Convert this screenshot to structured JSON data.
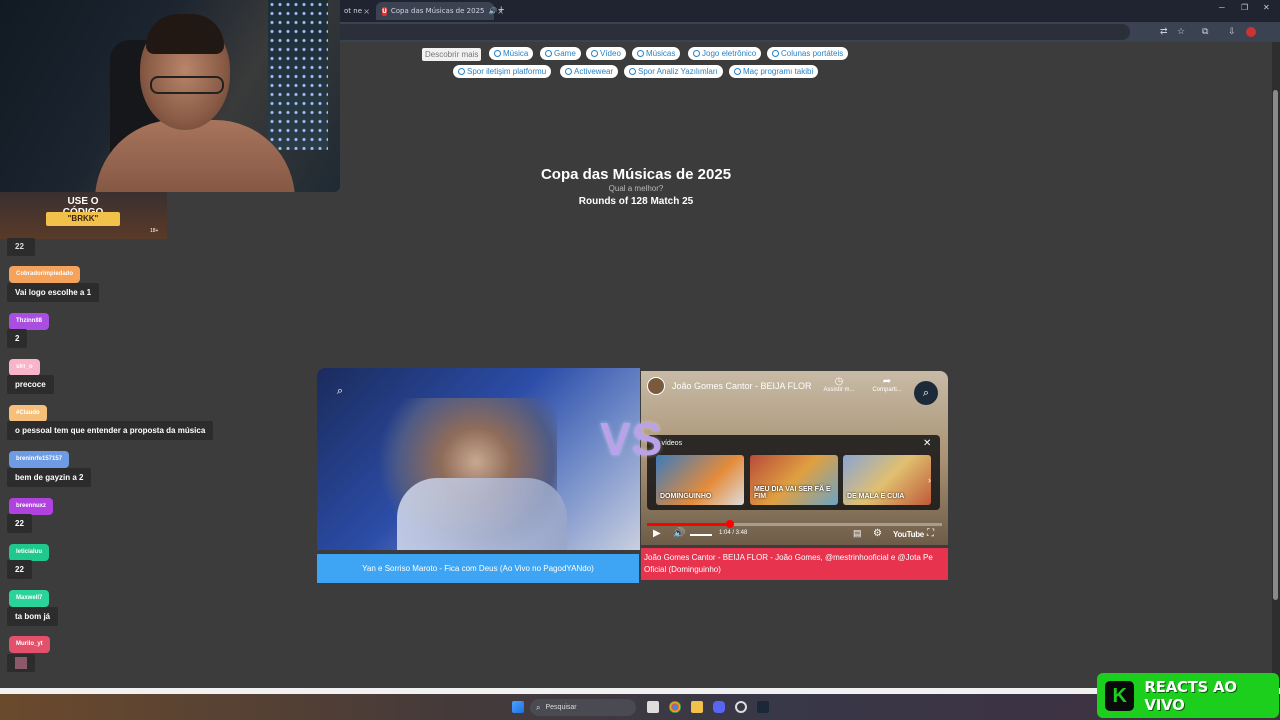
{
  "browser": {
    "prev_tab_label": "ot ne",
    "active_tab_label": "Copa das Músicas de 2025",
    "active_tab_favicon": "U",
    "new_tab": "+",
    "close": "×"
  },
  "chips": {
    "discover": "Descobrir mais",
    "row1": [
      "Música",
      "Game",
      "Vídeo",
      "Músicas",
      "Jogo eletrônico",
      "Colunas portáteis"
    ],
    "row2": [
      "Spor iletişim platformu",
      "Activewear",
      "Spor Analiz Yazılımları",
      "Maç programı takibi"
    ]
  },
  "page": {
    "title": "Copa das Músicas de 2025",
    "subtitle": "Qual a melhor?",
    "round": "Rounds of 128 Match 25",
    "vs": "VS"
  },
  "left_video": {
    "caption": "Yan e Sorriso Maroto - Fica com Deus (Ao Vivo no PagodYANdo)"
  },
  "right_video": {
    "yt_title": "João Gomes Cantor - BEIJA FLOR",
    "watch_later": "Assistir m...",
    "share": "Comparti...",
    "more_videos": "s vídeos",
    "thumbs": [
      "DOMINGUINHO",
      "MEU DIA VAI SER FÃ E FIM",
      "DE MALA E CUIA"
    ],
    "timecode": "1:04 / 3:48",
    "progress": 0.28,
    "youtube_logo": "YouTube",
    "caption": "João Gomes Cantor - BEIJA FLOR - João Gomes, @mestrinhooficial e @Jota Pe Oficial (Dominguinho)"
  },
  "promo": {
    "title": "USE O CÓDIGO",
    "code": "\"BRKK\"",
    "age": "18+"
  },
  "chat": {
    "top_count": "22",
    "messages": [
      {
        "user": "Cobradorimpiedado",
        "text": "Vai logo escolhe a 1",
        "color": "#f5a25a"
      },
      {
        "user": "Thzinn88",
        "text": "2",
        "color": "#a84ee0"
      },
      {
        "user": "slrr_o",
        "text": "precoce",
        "color": "#f8b4c8"
      },
      {
        "user": "#Claudo",
        "text": "o pessoal tem que entender a proposta da música",
        "color": "#f6c07a"
      },
      {
        "user": "breninrfe157157",
        "text": "bem de gayzin a 2",
        "color": "#6d9be4"
      },
      {
        "user": "breennuxz",
        "text": "22",
        "color": "#b043e0"
      },
      {
        "user": "leticialuu",
        "text": "22",
        "color": "#1fc98e"
      },
      {
        "user": "Maxwell7",
        "text": "ta bom já",
        "color": "#2ad39a"
      },
      {
        "user": "Murilo_yt",
        "text": "",
        "color": "#e2506a"
      }
    ]
  },
  "taskbar": {
    "search_placeholder": "Pesquisar"
  },
  "reacts": {
    "logo_letter": "K",
    "text": "REACTS AO VIVO"
  }
}
